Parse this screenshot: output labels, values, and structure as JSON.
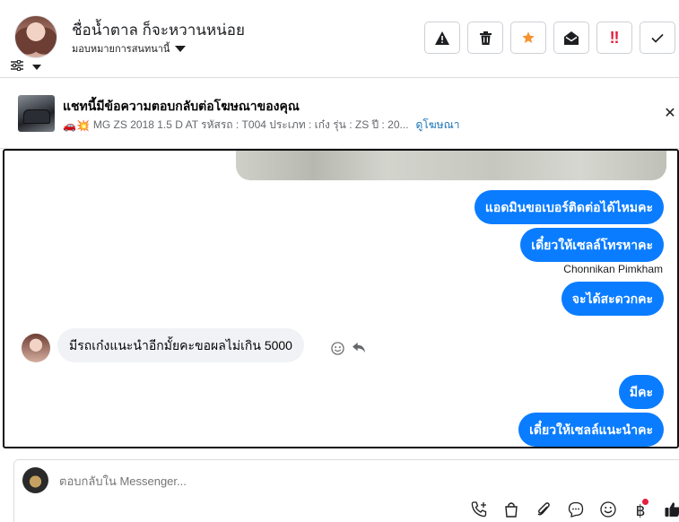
{
  "header": {
    "contact_name": "ชื่อน้ำตาล ก็จะหวานหน่อย",
    "assign_label": "มอบหมายการสนทนานี้",
    "tools": [
      {
        "name": "report-spam-button",
        "icon": "warning-icon",
        "glyph": "⚠",
        "color": "#1c1e21"
      },
      {
        "name": "delete-button",
        "icon": "trash-icon",
        "glyph": "🗑",
        "color": "#1c1e21"
      },
      {
        "name": "star-button",
        "icon": "star-icon",
        "glyph": "★",
        "color": "#f7922f"
      },
      {
        "name": "mark-unread-button",
        "icon": "envelope-open-icon",
        "glyph": "✉",
        "color": "#1c1e21"
      },
      {
        "name": "follow-up-button",
        "icon": "double-exclamation-icon",
        "glyph": "‼",
        "color": "#e41e3f"
      },
      {
        "name": "mark-done-button",
        "icon": "check-icon",
        "glyph": "✓",
        "color": "#1c1e21"
      }
    ]
  },
  "ad": {
    "title": "แชทนี้มีข้อความตอบกลับต่อโฆษณาของคุณ",
    "detail": "MG ZS 2018 1.5 D AT รหัสรถ : T004 ประเภท : เก๋ง รุ่น : ZS ปี : 20...",
    "link": "ดูโฆษณา",
    "emoji": "🚗💥"
  },
  "messages": {
    "out_1": "แอดมินขอเบอร์ติดต่อได้ไหมคะ",
    "out_2": "เดี๋ยวให้เซลล์โทรหาคะ",
    "sender": "Chonnikan Pimkham",
    "out_3": "จะได้สะดวกคะ",
    "in_1": "มีรถเก๋งแนะนำอีกมั้ยคะขอผลไม่เกิน 5000",
    "out_4": "มีคะ",
    "out_5": "เดี๋ยวให้เซลล์แนะนำคะ"
  },
  "composer": {
    "placeholder": "ตอบกลับใน Messenger..."
  },
  "colors": {
    "accent": "#0a7cff",
    "incoming_bubble": "#f0f2f5"
  }
}
